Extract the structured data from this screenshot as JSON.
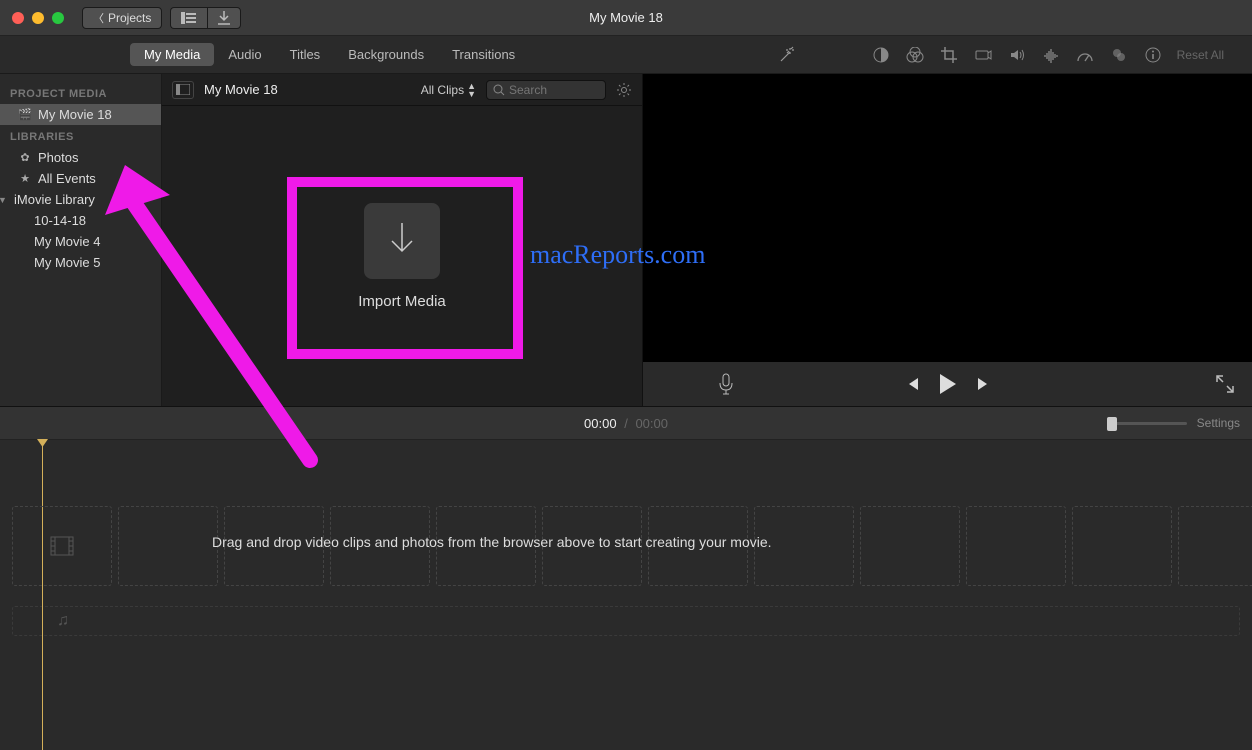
{
  "window": {
    "title": "My Movie 18"
  },
  "titlebar": {
    "projects_label": "Projects"
  },
  "tabs": {
    "my_media": "My Media",
    "audio": "Audio",
    "titles": "Titles",
    "backgrounds": "Backgrounds",
    "transitions": "Transitions",
    "reset_all": "Reset All"
  },
  "sidebar": {
    "project_media_header": "PROJECT MEDIA",
    "project_name": "My Movie 18",
    "libraries_header": "LIBRARIES",
    "photos": "Photos",
    "all_events": "All Events",
    "imovie_library": "iMovie Library",
    "events": [
      "10-14-18",
      "My Movie 4",
      "My Movie 5"
    ]
  },
  "browser": {
    "title": "My Movie 18",
    "filter": "All Clips",
    "search_placeholder": "Search",
    "import_label": "Import Media"
  },
  "timeline": {
    "current_time": "00:00",
    "duration": "00:00",
    "settings_label": "Settings",
    "hint": "Drag and drop video clips and photos from the browser above to start creating your movie."
  },
  "watermark": "macReports.com"
}
